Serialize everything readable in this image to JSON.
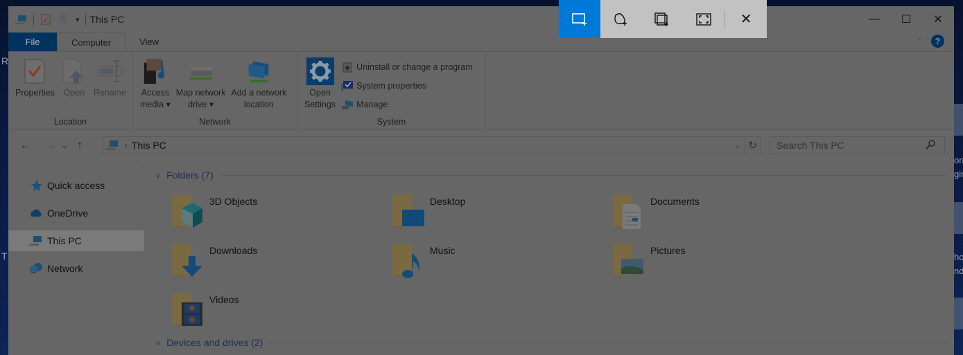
{
  "window": {
    "title": "This PC",
    "controls": {
      "minimize": "—",
      "maximize": "☐",
      "close": "✕"
    }
  },
  "desktop": {
    "left_labels": [
      "R",
      "T"
    ],
    "right_labels": [
      "orr",
      "gin",
      "ho",
      "nd"
    ]
  },
  "snip_toolbar": {
    "tools": [
      {
        "name": "rectangular-snip",
        "active": true
      },
      {
        "name": "freeform-snip",
        "active": false
      },
      {
        "name": "window-snip",
        "active": false
      },
      {
        "name": "fullscreen-snip",
        "active": false
      }
    ],
    "close_label": "✕",
    "accent": "#0078d7"
  },
  "ribbon": {
    "tabs": [
      {
        "label": "File"
      },
      {
        "label": "Computer",
        "active": true
      },
      {
        "label": "View"
      }
    ],
    "groups": {
      "location": {
        "label": "Location",
        "buttons": [
          {
            "label": "Properties",
            "enabled": true
          },
          {
            "label": "Open",
            "enabled": false
          },
          {
            "label": "Rename",
            "enabled": false
          }
        ]
      },
      "network": {
        "label": "Network",
        "buttons": [
          {
            "line1": "Access",
            "line2": "media ▾"
          },
          {
            "line1": "Map network",
            "line2": "drive ▾"
          },
          {
            "line1": "Add a network",
            "line2": "location"
          }
        ]
      },
      "system": {
        "label": "System",
        "open_settings": {
          "line1": "Open",
          "line2": "Settings"
        },
        "items": [
          {
            "label": "Uninstall or change a program"
          },
          {
            "label": "System properties"
          },
          {
            "label": "Manage"
          }
        ]
      }
    },
    "help_label": "?",
    "collapse_label": "⌃"
  },
  "navigation": {
    "back": "←",
    "forward": "→",
    "recent": "⌄",
    "up": "↑",
    "breadcrumb_sep": "›",
    "location": "This PC",
    "refresh": "↻",
    "search_placeholder": "Search This PC"
  },
  "sidebar": {
    "items": [
      {
        "label": "Quick access",
        "icon": "star-icon"
      },
      {
        "label": "OneDrive",
        "icon": "cloud-icon"
      },
      {
        "label": "This PC",
        "icon": "computer-icon",
        "selected": true
      },
      {
        "label": "Network",
        "icon": "network-icon"
      }
    ]
  },
  "content": {
    "folders_header": "Folders (7)",
    "folders": [
      {
        "name": "3D Objects"
      },
      {
        "name": "Desktop"
      },
      {
        "name": "Documents"
      },
      {
        "name": "Downloads"
      },
      {
        "name": "Music"
      },
      {
        "name": "Pictures"
      },
      {
        "name": "Videos"
      }
    ],
    "devices_header": "Devices and drives (2)"
  }
}
